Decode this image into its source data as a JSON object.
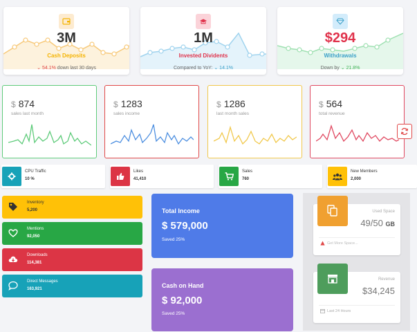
{
  "stats": [
    {
      "value": "3M",
      "label": "Cash Deposits",
      "label_color": "#f5b300",
      "icon_bg": "#fdebd0",
      "icon": "wallet-icon",
      "change": "54.1%",
      "change_prefix": "⌄",
      "change_color": "#e04848",
      "sub": "down last 30 days",
      "line_color": "#f7c97a",
      "bg_fill": "#fdf2dd"
    },
    {
      "value": "1M",
      "label": "Invested Dividents",
      "label_color": "#e0324b",
      "icon_bg": "#fbd3d9",
      "icon": "graduation-cap-icon",
      "sub_pre": "Compared to YoY:",
      "change": "14.1%",
      "change_prefix": "⌄",
      "change_color": "#3aa0c8",
      "line_color": "#9fd3ee",
      "bg_fill": "#e4f3fb"
    },
    {
      "value": "$294",
      "label": "Withdrawals",
      "label_color": "#3aa0c8",
      "icon_bg": "#d3ecfb",
      "icon": "diamond-icon",
      "sub_pre": "Down by",
      "change": "21.8%",
      "change_prefix": "⌄",
      "change_color": "#44b35a",
      "line_color": "#9ee0b1",
      "bg_fill": "#e5f7eb",
      "value_color": "#e0324b"
    }
  ],
  "spark_cards": [
    {
      "currency": "$",
      "value": "874",
      "caption": "sales last month",
      "color": "#5ecb7a"
    },
    {
      "currency": "$",
      "value": "1283",
      "caption": "sales income",
      "color": "#4d8fe0"
    },
    {
      "currency": "$",
      "value": "1286",
      "caption": "last month sales",
      "color": "#f1c84b"
    },
    {
      "currency": "$",
      "value": "564",
      "caption": "total revenue",
      "color": "#e04860"
    }
  ],
  "mini_stats": [
    {
      "title": "CPU Traffic",
      "value": "10 %",
      "color": "#17a2b8",
      "icon": "gear-icon"
    },
    {
      "title": "Likes",
      "value": "41,410",
      "color": "#dc3545",
      "icon": "thumbs-up-icon"
    },
    {
      "title": "Sales",
      "value": "760",
      "color": "#28a745",
      "icon": "cart-icon"
    },
    {
      "title": "New Members",
      "value": "2,000",
      "color": "#ffc107",
      "icon": "users-icon"
    }
  ],
  "bars": [
    {
      "title": "Inventory",
      "value": "5,200",
      "color": "#ffc107",
      "text_color": "#333",
      "icon": "tag-icon"
    },
    {
      "title": "Mentions",
      "value": "92,050",
      "color": "#28a745",
      "text_color": "#fff",
      "icon": "heart-icon"
    },
    {
      "title": "Downloads",
      "value": "114,381",
      "color": "#dc3545",
      "text_color": "#fff",
      "icon": "cloud-download-icon"
    },
    {
      "title": "Direct Messages",
      "value": "163,921",
      "color": "#17a2b8",
      "text_color": "#fff",
      "icon": "chat-icon"
    }
  ],
  "income": {
    "title": "Total Income",
    "value": "$ 579,000",
    "saved": "Saved 25%",
    "color": "#4f7be8"
  },
  "cash": {
    "title": "Cash on Hand",
    "value": "$ 92,000",
    "saved": "Saved 25%",
    "color": "#9b6fd0"
  },
  "space": {
    "label": "Used Space",
    "value": "49/50",
    "unit": "GB",
    "footer": "Get More Space...",
    "color": "#f0a030",
    "icon": "copy-icon"
  },
  "revenue": {
    "label": "Revenue",
    "value": "$34,245",
    "footer": "Last 24 Hours",
    "color": "#4e9d5c",
    "icon": "store-icon"
  }
}
